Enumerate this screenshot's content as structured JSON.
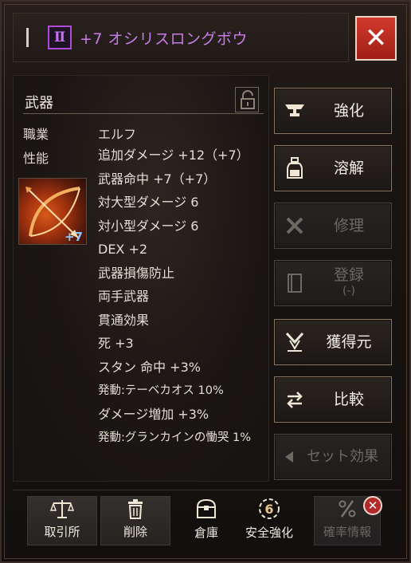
{
  "header": {
    "grade_icon": "roman-two-badge",
    "grade_numeral": "Ⅱ",
    "item_name": "+7  オシリスロングボウ",
    "close_label": "✕"
  },
  "info": {
    "category": "武器",
    "lock_icon": "lock-icon",
    "class_label": "職業",
    "class_value": "エルフ",
    "perf_label": "性能",
    "enhance_label": "+7",
    "stats": [
      "追加ダメージ  +12（+7）",
      "武器命中  +7（+7）",
      "対大型ダメージ  6",
      "対小型ダメージ  6",
      "DEX  +2",
      "武器損傷防止",
      "両手武器",
      "貫通効果",
      "死  +3",
      "スタン  命中  +3%",
      "発動:テーベカオス  10%",
      "ダメージ増加  +3%",
      "発動:グランカインの慟哭  1%"
    ]
  },
  "actions": {
    "enhance": "強化",
    "dissolve": "溶解",
    "repair": "修理",
    "register": "登録",
    "register_sub": "(-)",
    "source": "獲得元",
    "compare": "比較",
    "set_effect": "セット効果"
  },
  "bottom": {
    "exchange": "取引所",
    "delete": "削除",
    "warehouse": "倉庫",
    "safe_enhance": "安全強化",
    "safe_enhance_count": "6",
    "probability": "確率情報",
    "notif": "✕"
  },
  "colors": {
    "grade_purple": "#c77de8",
    "close_red": "#c5312a",
    "enhance_blue": "#8ec7ff",
    "accent_gold": "#e8c38a"
  }
}
